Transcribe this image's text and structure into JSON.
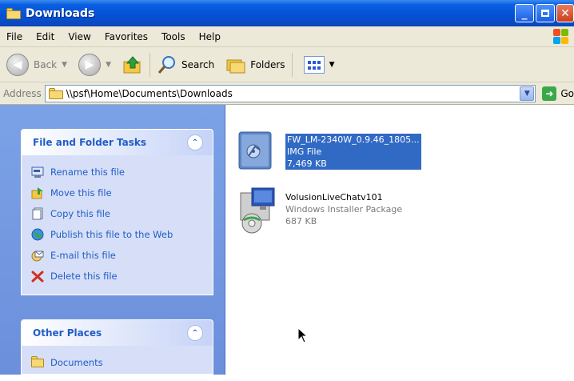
{
  "window": {
    "title": "Downloads"
  },
  "menu": [
    "File",
    "Edit",
    "View",
    "Favorites",
    "Tools",
    "Help"
  ],
  "toolbar": {
    "back_label": "Back",
    "search_label": "Search",
    "folders_label": "Folders"
  },
  "address": {
    "label": "Address",
    "path": "\\\\psf\\Home\\Documents\\Downloads",
    "go_label": "Go"
  },
  "tasks": {
    "file_folder": {
      "title": "File and Folder Tasks",
      "items": [
        {
          "label": "Rename this file",
          "icon": "rename-icon"
        },
        {
          "label": "Move this file",
          "icon": "move-icon"
        },
        {
          "label": "Copy this file",
          "icon": "copy-icon"
        },
        {
          "label": "Publish this file to the Web",
          "icon": "globe-icon"
        },
        {
          "label": "E-mail this file",
          "icon": "email-icon"
        },
        {
          "label": "Delete this file",
          "icon": "delete-icon"
        }
      ]
    },
    "other_places": {
      "title": "Other Places",
      "items": [
        {
          "label": "Documents",
          "icon": "folder-icon"
        }
      ]
    }
  },
  "files": [
    {
      "name": "FW_LM-2340W_0.9.46_1805...",
      "type": "IMG File",
      "size": "7,469 KB",
      "selected": true,
      "icon": "disc-image-icon"
    },
    {
      "name": "VolusionLiveChatv101",
      "type": "Windows Installer Package",
      "size": "687 KB",
      "selected": false,
      "icon": "installer-icon"
    }
  ],
  "colors": {
    "titlebar": "#0551d6",
    "selection": "#316ac5",
    "task_link": "#215dc6",
    "taskpane": "#7ba2e7"
  }
}
